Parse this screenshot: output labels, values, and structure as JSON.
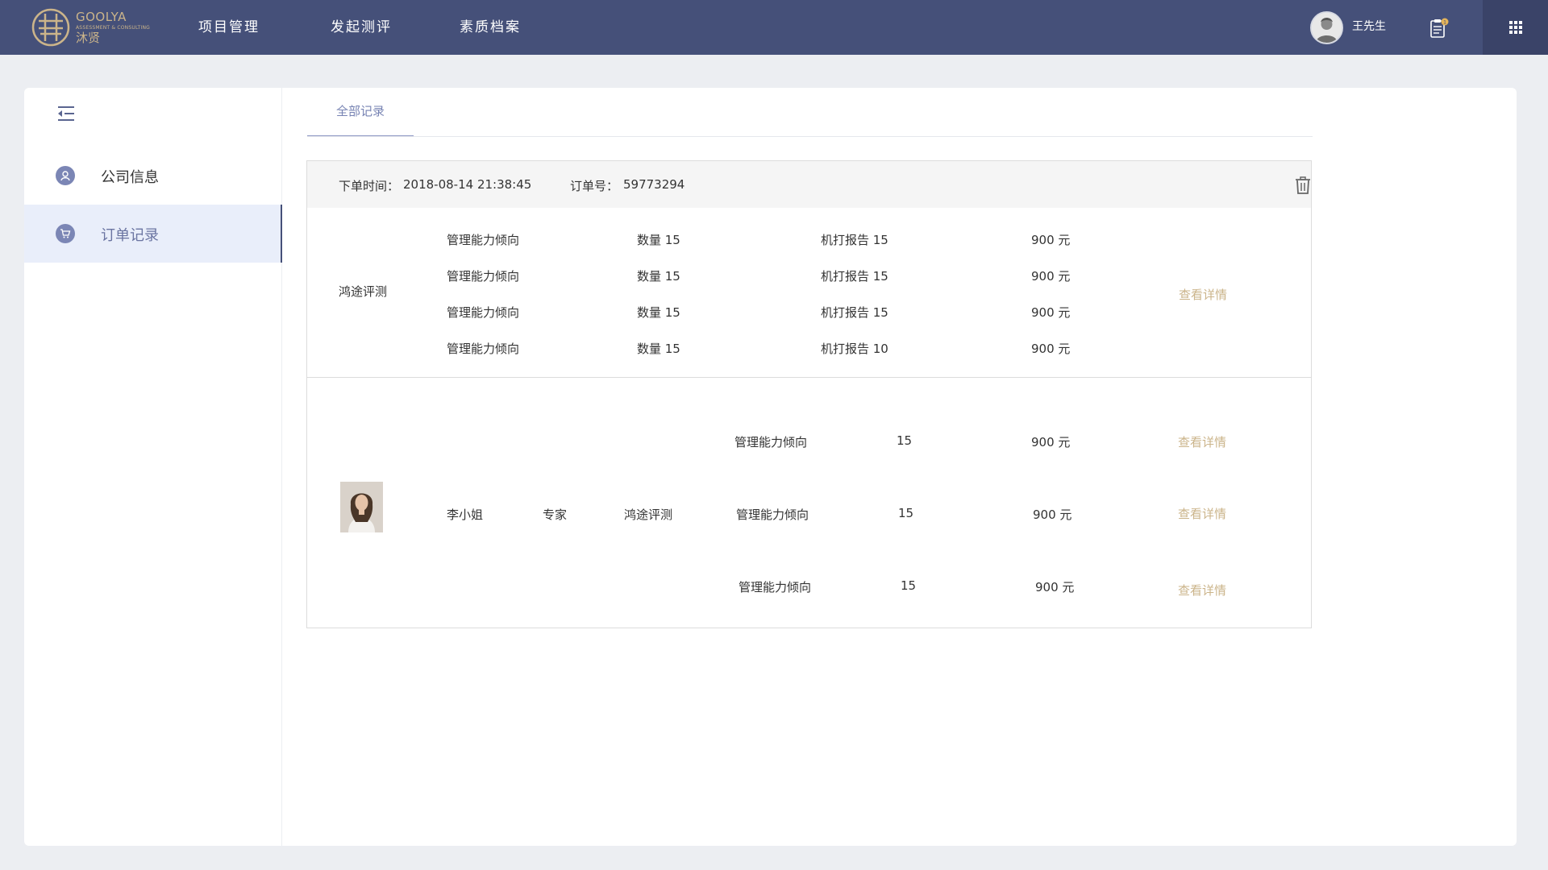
{
  "header": {
    "logo": {
      "en": "GOOLYA",
      "sub": "ASSESSMENT & CONSULTING",
      "cn": "沐贤"
    },
    "nav": [
      {
        "label": "项目管理"
      },
      {
        "label": "发起测评"
      },
      {
        "label": "素质档案"
      }
    ],
    "user_name": "王先生",
    "notification_count": "1"
  },
  "sidebar": {
    "items": [
      {
        "label": "公司信息",
        "icon": "user-icon",
        "active": false
      },
      {
        "label": "订单记录",
        "icon": "cart-icon",
        "active": true
      }
    ]
  },
  "tabs": [
    {
      "label": "全部记录",
      "active": true
    }
  ],
  "order": {
    "time_label": "下单时间：",
    "time_value": "2018-08-14 21:38:45",
    "number_label": "订单号：",
    "number_value": "59773294",
    "group1": {
      "name": "鸿途评测",
      "rows": [
        {
          "item": "管理能力倾向",
          "qty": "数量 15",
          "report": "机打报告 15",
          "price": "900 元"
        },
        {
          "item": "管理能力倾向",
          "qty": "数量 15",
          "report": "机打报告 15",
          "price": "900 元"
        },
        {
          "item": "管理能力倾向",
          "qty": "数量 15",
          "report": "机打报告 15",
          "price": "900 元"
        },
        {
          "item": "管理能力倾向",
          "qty": "数量 15",
          "report": "机打报告 10",
          "price": "900 元"
        }
      ],
      "detail_link": "查看详情"
    },
    "group2": {
      "person_name": "李小姐",
      "person_role": "专家",
      "org": "鸿途评测",
      "rows": [
        {
          "item": "管理能力倾向",
          "qty": "15",
          "price": "900 元",
          "link": "查看详情"
        },
        {
          "item": "管理能力倾向",
          "qty": "15",
          "price": "900 元",
          "link": "查看详情"
        },
        {
          "item": "管理能力倾向",
          "qty": "15",
          "price": "900 元",
          "link": "查看详情"
        }
      ]
    }
  },
  "colors": {
    "header_bg": "#455079",
    "accent_gold": "#cbb48a",
    "active_bg": "#e9eefa",
    "tab_text": "#7783b3"
  }
}
